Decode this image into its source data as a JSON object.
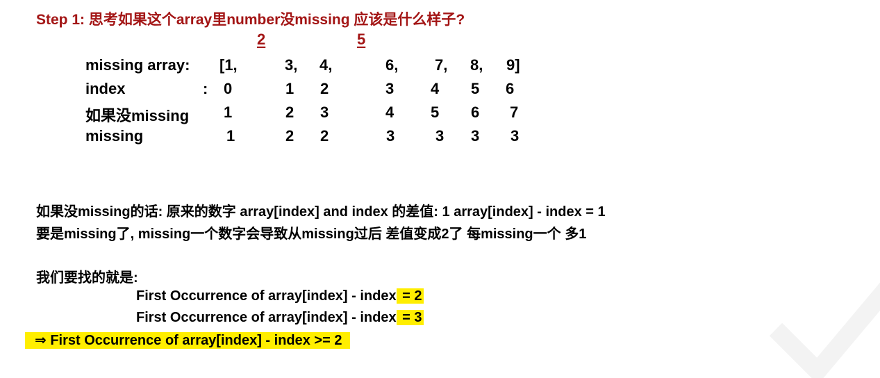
{
  "title": "Step 1: 思考如果这个array里number没missing 应该是什么样子?",
  "missing_marks": [
    "2",
    "5"
  ],
  "rows": [
    {
      "label": "missing array:",
      "sep": "",
      "cells": [
        "[1,",
        "3,",
        "4,",
        "6,",
        "7,",
        "8,",
        "9]"
      ]
    },
    {
      "label": "index",
      "sep": ":",
      "cells": [
        "0",
        "1",
        "2",
        "3",
        "4",
        "5",
        "6"
      ]
    },
    {
      "label": "如果没missing",
      "sep": "",
      "cells": [
        "1",
        "2",
        "3",
        "4",
        "5",
        "6",
        "7"
      ]
    },
    {
      "label": "missing",
      "sep": "",
      "cells": [
        "1",
        "2",
        "2",
        "3",
        "3",
        "3",
        "3"
      ]
    }
  ],
  "paragraph": {
    "line1": "如果没missing的话:  原来的数字  array[index] and index 的差值:  1  array[index] - index = 1",
    "line2": "要是missing了,  missing一个数字会导致从missing过后 差值变成2了  每missing一个 多1"
  },
  "goal_heading": "我们要找的就是:",
  "formulas": [
    {
      "text": "First Occurrence of array[index] - index",
      "highlight": " = 2"
    },
    {
      "text": "First Occurrence of array[index] - index",
      "highlight": " = 3"
    }
  ],
  "conclusion": "⇒ First Occurrence of array[index] - index >= 2"
}
